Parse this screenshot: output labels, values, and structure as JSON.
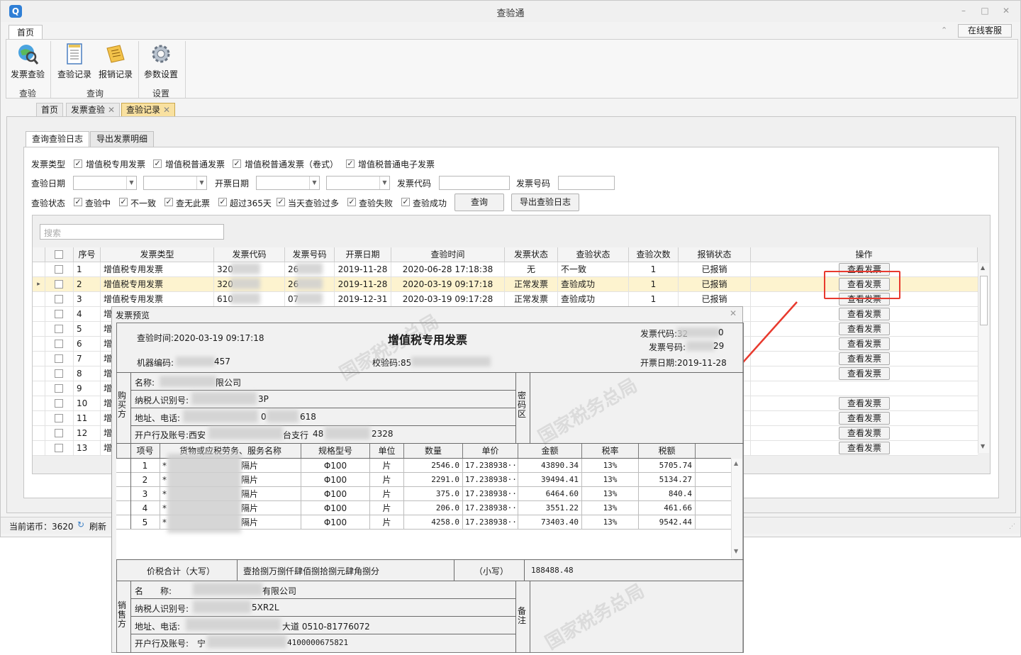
{
  "window": {
    "title": "查验通"
  },
  "ribbon": {
    "tab": "首页",
    "online_service": "在线客服",
    "buttons": [
      {
        "label": "发票查验",
        "icon": "globe-search-icon"
      },
      {
        "label": "查验记录",
        "icon": "document-list-icon"
      },
      {
        "label": "报销记录",
        "icon": "receipt-icon"
      },
      {
        "label": "参数设置",
        "icon": "gear-icon"
      }
    ],
    "groups": [
      "查验",
      "查询",
      "设置"
    ]
  },
  "doc_tabs": [
    {
      "label": "首页",
      "closable": false
    },
    {
      "label": "发票查验",
      "closable": true
    },
    {
      "label": "查验记录",
      "closable": true,
      "active": true
    }
  ],
  "sub_tabs": [
    "查询查验日志",
    "导出发票明细"
  ],
  "filters": {
    "invoice_type_label": "发票类型",
    "invoice_types": [
      "增值税专用发票",
      "增值税普通发票",
      "增值税普通发票（卷式）",
      "增值税普通电子发票"
    ],
    "check_date_label": "查验日期",
    "issue_date_label": "开票日期",
    "code_label": "发票代码",
    "number_label": "发票号码",
    "status_label": "查验状态",
    "statuses": [
      "查验中",
      "不一致",
      "查无此票",
      "超过365天",
      "当天查验过多",
      "查验失败",
      "查验成功"
    ],
    "query_button": "查询",
    "export_button": "导出查验日志"
  },
  "grid": {
    "search_placeholder": "搜索",
    "columns": [
      "序号",
      "发票类型",
      "发票代码",
      "发票号码",
      "开票日期",
      "查验时间",
      "发票状态",
      "查验状态",
      "查验次数",
      "报销状态",
      "操作"
    ],
    "view_label": "查看发票",
    "rows": [
      {
        "no": "1",
        "type": "增值税专用发票",
        "code": "320",
        "num": "26",
        "date": "2019-11-28",
        "time": "2020-06-28 17:18:38",
        "inv_status": "无",
        "chk_status": "不一致",
        "count": "1",
        "reimb": "已报销"
      },
      {
        "no": "2",
        "type": "增值税专用发票",
        "code": "320",
        "num": "26",
        "date": "2019-11-28",
        "time": "2020-03-19 09:17:18",
        "inv_status": "正常发票",
        "chk_status": "查验成功",
        "count": "1",
        "reimb": "已报销"
      },
      {
        "no": "3",
        "type": "增值税专用发票",
        "code": "610",
        "num": "07",
        "date": "2019-12-31",
        "time": "2020-03-19 09:17:28",
        "inv_status": "正常发票",
        "chk_status": "查验成功",
        "count": "1",
        "reimb": "已报销"
      },
      {
        "no": "4",
        "type": "增"
      },
      {
        "no": "5",
        "type": "增"
      },
      {
        "no": "6",
        "type": "增"
      },
      {
        "no": "7",
        "type": "增"
      },
      {
        "no": "8",
        "type": "增"
      },
      {
        "no": "9",
        "type": "增"
      },
      {
        "no": "10",
        "type": "增"
      },
      {
        "no": "11",
        "type": "增"
      },
      {
        "no": "12",
        "type": "增"
      },
      {
        "no": "13",
        "type": "增"
      }
    ]
  },
  "status_bar": {
    "credits": "当前诺币：3620",
    "refresh": "刷新"
  },
  "preview": {
    "dialog_title": "发票预览",
    "title": "增值税专用发票",
    "check_time": "查验时间:2020-03-19 09:17:18",
    "machine_code": "机器编码:",
    "machine_code_tail": "457",
    "check_code": "校验码:85",
    "invoice_code": "发票代码:32",
    "invoice_code_tail": "0",
    "invoice_number": "发票号码:",
    "invoice_number_tail": "29",
    "issue_date": "开票日期:2019-11-28",
    "buyer_label": "购买方",
    "buyer_name": "名称:",
    "buyer_name_tail": "限公司",
    "buyer_tax_id": "纳税人识别号:",
    "buyer_tax_tail": "3P",
    "buyer_addr": "地址、电话:",
    "buyer_addr_a": "0",
    "buyer_addr_b": "618",
    "buyer_bank": "开户行及账号:西安",
    "buyer_bank_a": "台支行",
    "buyer_bank_b": "48",
    "buyer_bank_c": "2328",
    "cipher_label": "密码区",
    "item_columns": [
      "项号",
      "货物或应税劳务、服务名称",
      "规格型号",
      "单位",
      "数量",
      "单价",
      "金额",
      "税率",
      "税额"
    ],
    "items": [
      {
        "no": "1",
        "name_head": "*",
        "name_tail": "隔片",
        "spec": "Φ100",
        "unit": "片",
        "qty": "2546.0",
        "price": "17.238938···",
        "amount": "43890.34",
        "rate": "13%",
        "tax": "5705.74"
      },
      {
        "no": "2",
        "name_head": "*",
        "name_tail": "隔片",
        "spec": "Φ100",
        "unit": "片",
        "qty": "2291.0",
        "price": "17.238938···",
        "amount": "39494.41",
        "rate": "13%",
        "tax": "5134.27"
      },
      {
        "no": "3",
        "name_head": "*",
        "name_tail": "隔片",
        "spec": "Φ100",
        "unit": "片",
        "qty": "375.0",
        "price": "17.238938···",
        "amount": "6464.60",
        "rate": "13%",
        "tax": "840.4"
      },
      {
        "no": "4",
        "name_head": "*",
        "name_tail": "隔片",
        "spec": "Φ100",
        "unit": "片",
        "qty": "206.0",
        "price": "17.238938···",
        "amount": "3551.22",
        "rate": "13%",
        "tax": "461.66"
      },
      {
        "no": "5",
        "name_head": "*",
        "name_tail": "隔片",
        "spec": "Φ100",
        "unit": "片",
        "qty": "4258.0",
        "price": "17.238938···",
        "amount": "73403.40",
        "rate": "13%",
        "tax": "9542.44"
      }
    ],
    "total_label": "价税合计（大写）",
    "total_upper": "壹拾捌万捌仟肆佰捌拾捌元肆角捌分",
    "total_small_label": "（小写）",
    "total_small": "188488.48",
    "seller_label": "销售方",
    "seller_name": "名　　称:",
    "seller_name_tail": "有限公司",
    "seller_tax_id": "纳税人识别号:",
    "seller_tax_tail": "5XR2L",
    "seller_addr": "地址、电话:",
    "seller_addr_tail": "大道 0510-81776072",
    "seller_bank": "开户行及账号:",
    "seller_bank_a": "宁",
    "seller_bank_tail": "4100000675821",
    "remarks_label": "备注",
    "watermark": "国家税务总局"
  },
  "colors": {
    "highlight_box": "#e83a2e",
    "selected_row": "#fdf3cf",
    "active_tab": "#f9e1a0"
  }
}
